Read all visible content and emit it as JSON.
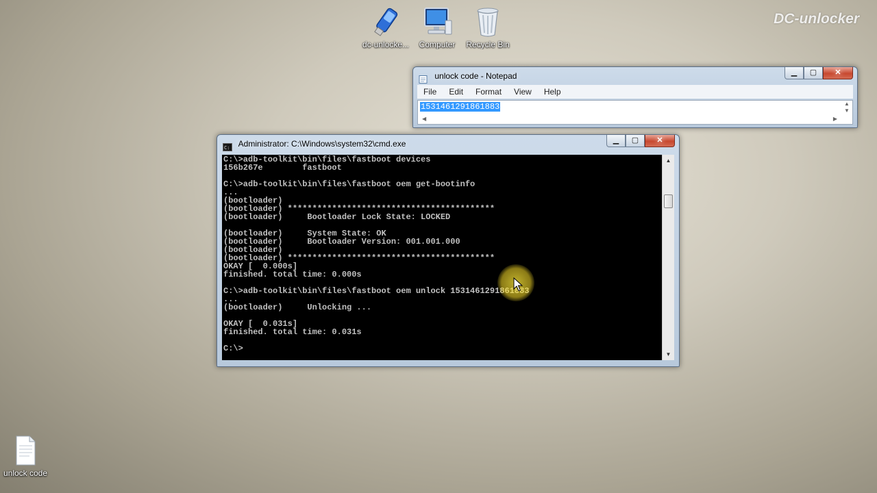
{
  "watermark": "DC-unlocker",
  "desktop": {
    "icons": [
      {
        "label": "dc-unlocke...",
        "icon": "usb-modem-icon"
      },
      {
        "label": "Computer",
        "icon": "computer-icon"
      },
      {
        "label": "Recycle Bin",
        "icon": "recycle-bin-icon"
      },
      {
        "label": "unlock code",
        "icon": "text-file-icon"
      }
    ]
  },
  "notepad": {
    "title": "unlock code - Notepad",
    "menu": [
      "File",
      "Edit",
      "Format",
      "View",
      "Help"
    ],
    "content": "1531461291861883",
    "controls": {
      "minimize": "▁",
      "maximize": "▢",
      "close": "✕"
    }
  },
  "cmd": {
    "title": "Administrator: C:\\Windows\\system32\\cmd.exe",
    "lines": [
      "C:\\>adb-toolkit\\bin\\files\\fastboot devices",
      "156b267e        fastboot",
      "",
      "C:\\>adb-toolkit\\bin\\files\\fastboot oem get-bootinfo",
      "...",
      "(bootloader)",
      "(bootloader) ******************************************",
      "(bootloader)     Bootloader Lock State: LOCKED",
      "",
      "(bootloader)     System State: OK",
      "(bootloader)     Bootloader Version: 001.001.000",
      "(bootloader)",
      "(bootloader) ******************************************",
      "OKAY [  0.000s]",
      "finished. total time: 0.000s",
      "",
      "C:\\>adb-toolkit\\bin\\files\\fastboot oem unlock 1531461291861883",
      "...",
      "(bootloader)     Unlocking ...",
      "",
      "OKAY [  0.031s]",
      "finished. total time: 0.031s",
      "",
      "C:\\>"
    ],
    "controls": {
      "minimize": "▁",
      "maximize": "▢",
      "close": "✕"
    }
  }
}
